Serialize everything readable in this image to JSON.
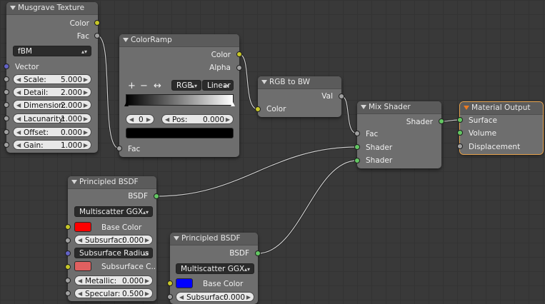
{
  "musgrave": {
    "title": "Musgrave Texture",
    "out_color": "Color",
    "out_fac": "Fac",
    "type_value": "fBM",
    "in_vector": "Vector",
    "fields": [
      {
        "label": "Scale:",
        "value": "5.000"
      },
      {
        "label": "Detail:",
        "value": "2.000"
      },
      {
        "label": "Dimension:",
        "value": "2.000"
      },
      {
        "label": "Lacunarity:",
        "value": "1.000"
      },
      {
        "label": "Offset:",
        "value": "0.000"
      },
      {
        "label": "Gain:",
        "value": "1.000"
      }
    ]
  },
  "colorramp": {
    "title": "ColorRamp",
    "out_color": "Color",
    "out_alpha": "Alpha",
    "add": "+",
    "remove": "−",
    "flip": "↔",
    "color_mode": "RGB",
    "interpolation": "Linear",
    "stop_index": "0",
    "pos_label": "Pos:",
    "pos_value": "0.000",
    "in_fac": "Fac"
  },
  "rgbtobw": {
    "title": "RGB to BW",
    "out_val": "Val",
    "in_color": "Color"
  },
  "mixshader": {
    "title": "Mix Shader",
    "out_shader": "Shader",
    "in_fac": "Fac",
    "in_shader1": "Shader",
    "in_shader2": "Shader"
  },
  "output": {
    "title": "Material Output",
    "surface": "Surface",
    "volume": "Volume",
    "displacement": "Displacement"
  },
  "bsdf1": {
    "title": "Principled BSDF",
    "out_bsdf": "BSDF",
    "distribution": "Multiscatter GGX",
    "base_color": "Base Color",
    "base_color_hex": "#ff0000",
    "subsurface_label": "Subsurfac:",
    "subsurface_value": "0.000",
    "subsurface_method": "Subsurface Radius",
    "subsurface_color": "Subsurface C...",
    "subsurface_color_hex": "#e06060",
    "metallic_label": "Metallic:",
    "metallic_value": "0.000",
    "specular_label": "Specular:",
    "specular_value": "0.500"
  },
  "bsdf2": {
    "title": "Principled BSDF",
    "out_bsdf": "BSDF",
    "distribution": "Multiscatter GGX",
    "base_color": "Base Color",
    "base_color_hex": "#0000ff",
    "subsurface_label": "Subsurfac:",
    "subsurface_value": "0.000"
  }
}
